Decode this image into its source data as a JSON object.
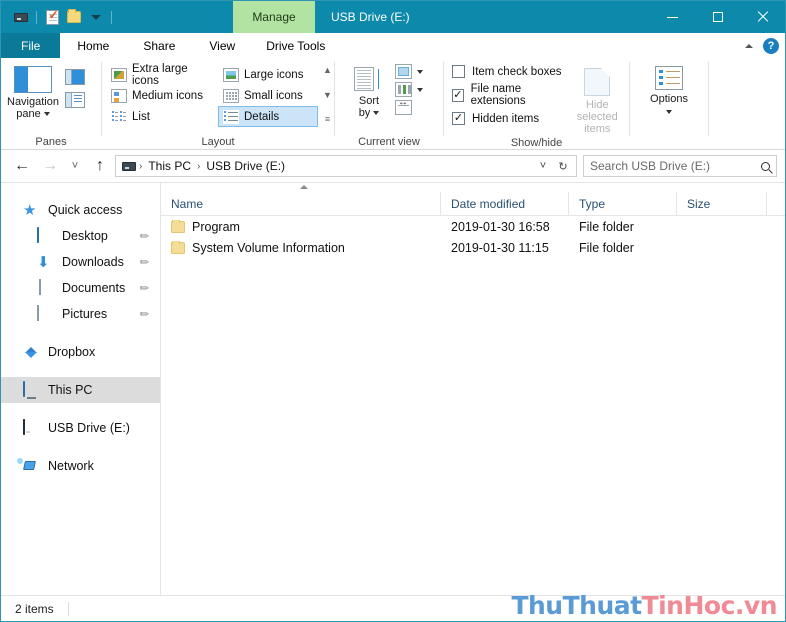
{
  "titlebar": {
    "window_title": "USB Drive (E:)",
    "manage_tab": "Manage",
    "quick_access": [
      {
        "name": "drive-icon",
        "label": "Drive"
      },
      {
        "name": "properties-icon",
        "label": "Properties"
      },
      {
        "name": "new-folder-icon",
        "label": "New folder"
      },
      {
        "name": "customize-caret-icon",
        "label": "Customize Quick Access Toolbar"
      }
    ],
    "minimize": "Minimize",
    "maximize": "Maximize",
    "close": "Close"
  },
  "tabs": {
    "file": "File",
    "home": "Home",
    "share": "Share",
    "view": "View",
    "drive_tools": "Drive Tools",
    "collapse_ribbon": "Collapse the Ribbon",
    "help": "?"
  },
  "ribbon": {
    "panes": {
      "group_label": "Panes",
      "navigation_pane": "Navigation\npane",
      "navigation_pane_line1": "Navigation",
      "navigation_pane_line2": "pane",
      "preview_pane": "Preview pane",
      "details_pane": "Details pane"
    },
    "layout": {
      "group_label": "Layout",
      "items": [
        {
          "label": "Extra large icons",
          "selected": false
        },
        {
          "label": "Large icons",
          "selected": false
        },
        {
          "label": "Medium icons",
          "selected": false
        },
        {
          "label": "Small icons",
          "selected": false
        },
        {
          "label": "List",
          "selected": false
        },
        {
          "label": "Details",
          "selected": true
        }
      ],
      "scroll_up": "▲",
      "scroll_down": "▼",
      "scroll_more": "≡"
    },
    "current_view": {
      "group_label": "Current view",
      "sort_by_line1": "Sort",
      "sort_by_line2": "by",
      "group_by": "Group by",
      "add_columns": "Add columns",
      "size_all_columns": "Size all columns to fit"
    },
    "show_hide": {
      "group_label": "Show/hide",
      "checkboxes": [
        {
          "label": "Item check boxes",
          "checked": false
        },
        {
          "label": "File name extensions",
          "checked": true
        },
        {
          "label": "Hidden items",
          "checked": true
        }
      ],
      "hide_selected_line1": "Hide selected",
      "hide_selected_line2": "items"
    },
    "options": {
      "group_label": "",
      "label": "Options"
    }
  },
  "addressbar": {
    "back": "←",
    "forward": "→",
    "recent": "˅",
    "up": "↑",
    "breadcrumbs": [
      "This PC",
      "USB Drive (E:)"
    ],
    "separator": "›",
    "dropdown": "˅",
    "refresh": "↻",
    "search_placeholder": "Search USB Drive (E:)",
    "search_value": ""
  },
  "sidebar": {
    "items": [
      {
        "label": "Quick access",
        "icon": "star-icon",
        "level": "root",
        "pinned": false,
        "selected": false
      },
      {
        "label": "Desktop",
        "icon": "desktop-icon",
        "level": "child",
        "pinned": true,
        "selected": false
      },
      {
        "label": "Downloads",
        "icon": "download-icon",
        "level": "child",
        "pinned": true,
        "selected": false
      },
      {
        "label": "Documents",
        "icon": "documents-icon",
        "level": "child",
        "pinned": true,
        "selected": false
      },
      {
        "label": "Pictures",
        "icon": "pictures-icon",
        "level": "child",
        "pinned": true,
        "selected": false
      },
      {
        "label": "Dropbox",
        "icon": "dropbox-icon",
        "level": "root",
        "pinned": false,
        "selected": false
      },
      {
        "label": "This PC",
        "icon": "this-pc-icon",
        "level": "root",
        "pinned": false,
        "selected": true
      },
      {
        "label": "USB Drive (E:)",
        "icon": "usb-drive-icon",
        "level": "root",
        "pinned": false,
        "selected": false
      },
      {
        "label": "Network",
        "icon": "network-icon",
        "level": "root",
        "pinned": false,
        "selected": false
      }
    ],
    "pin_glyph": "✐"
  },
  "filelist": {
    "columns": [
      "Name",
      "Date modified",
      "Type",
      "Size"
    ],
    "sort_column": "Name",
    "sort_direction": "ascending",
    "rows": [
      {
        "name": "Program",
        "date_modified": "2019-01-30 16:58",
        "type": "File folder",
        "size": ""
      },
      {
        "name": "System Volume Information",
        "date_modified": "2019-01-30 11:15",
        "type": "File folder",
        "size": ""
      }
    ]
  },
  "statusbar": {
    "item_count": "2 items"
  },
  "watermark": {
    "part_blue": "ThuThuat",
    "part_red": "TinHoc",
    "part_red2": ".vn"
  },
  "colors": {
    "titlebar": "#0d8aab",
    "manage_tab": "#b3e3a3",
    "selection": "#cce4f7",
    "sidebar_selected": "#dcdcdc",
    "accent_blue": "#2f8fd8",
    "watermark_blue": "#5b9bd5",
    "watermark_red": "#f08a94"
  }
}
